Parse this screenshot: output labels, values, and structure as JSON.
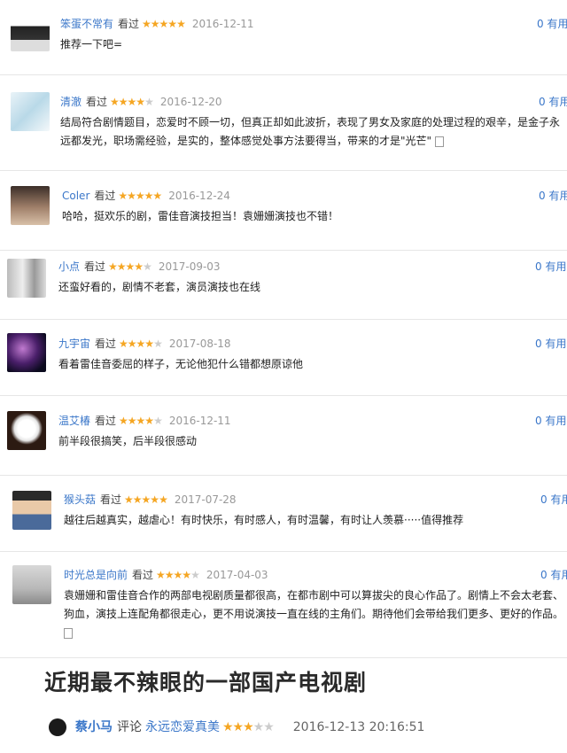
{
  "reviews": [
    {
      "user": "笨蛋不常有",
      "action": "看过",
      "stars": 5,
      "date": "2016-12-11",
      "useful": "0 有用",
      "text": [
        "推荐一下吧="
      ]
    },
    {
      "user": "清澈",
      "action": "看过",
      "stars": 4,
      "date": "2016-12-20",
      "useful": "0 有用",
      "text": [
        "结局符合剧情题目，恋爱时不顾一切，但真正却如此波折，表现了男女及家庭的处理过程的艰辛，是金子永",
        "远都发光，职场需经验，是实的，整体感觉处事方法要得当，带来的才是\"光芒\""
      ]
    },
    {
      "user": "Coler",
      "action": "看过",
      "stars": 5,
      "date": "2016-12-24",
      "useful": "0 有用",
      "text": [
        "哈哈，挺欢乐的剧，雷佳音演技担当！袁姗姗演技也不错！"
      ]
    },
    {
      "user": "小点",
      "action": "看过",
      "stars": 4,
      "date": "2017-09-03",
      "useful": "0 有用",
      "text": [
        "还蛮好看的，剧情不老套，演员演技也在线"
      ]
    },
    {
      "user": "九宇宙",
      "action": "看过",
      "stars": 4,
      "date": "2017-08-18",
      "useful": "0 有用",
      "text": [
        "看着雷佳音委屈的样子，无论他犯什么错都想原谅他"
      ]
    },
    {
      "user": "温艾椿",
      "action": "看过",
      "stars": 4,
      "date": "2016-12-11",
      "useful": "0 有用",
      "text": [
        "前半段很搞笑，后半段很感动"
      ]
    },
    {
      "user": "猴头菇",
      "action": "看过",
      "stars": 5,
      "date": "2017-07-28",
      "useful": "0 有用",
      "text": [
        "越往后越真实，越虐心！有时快乐，有时感人，有时温馨，有时让人羡慕·····值得推荐"
      ]
    },
    {
      "user": "时光总是向前",
      "action": "看过",
      "stars": 4,
      "date": "2017-04-03",
      "useful": "0 有用",
      "text": [
        "袁姗姗和雷佳音合作的两部电视剧质量都很高，在都市剧中可以算拔尖的良心作品了。剧情上不会太老套、",
        "狗血，演技上连配角都很走心，更不用说演技一直在线的主角们。期待他们会带给我们更多、更好的作品。"
      ]
    }
  ],
  "heading": "近期最不辣眼的一部国产电视剧",
  "bottom": {
    "user": "蔡小马",
    "action": "评论",
    "target": "永远恋爱真美",
    "stars": 3,
    "date": "2016-12-13 20:16:51"
  },
  "colors": {
    "link": "#3b77c9",
    "star": "#f5a623"
  }
}
